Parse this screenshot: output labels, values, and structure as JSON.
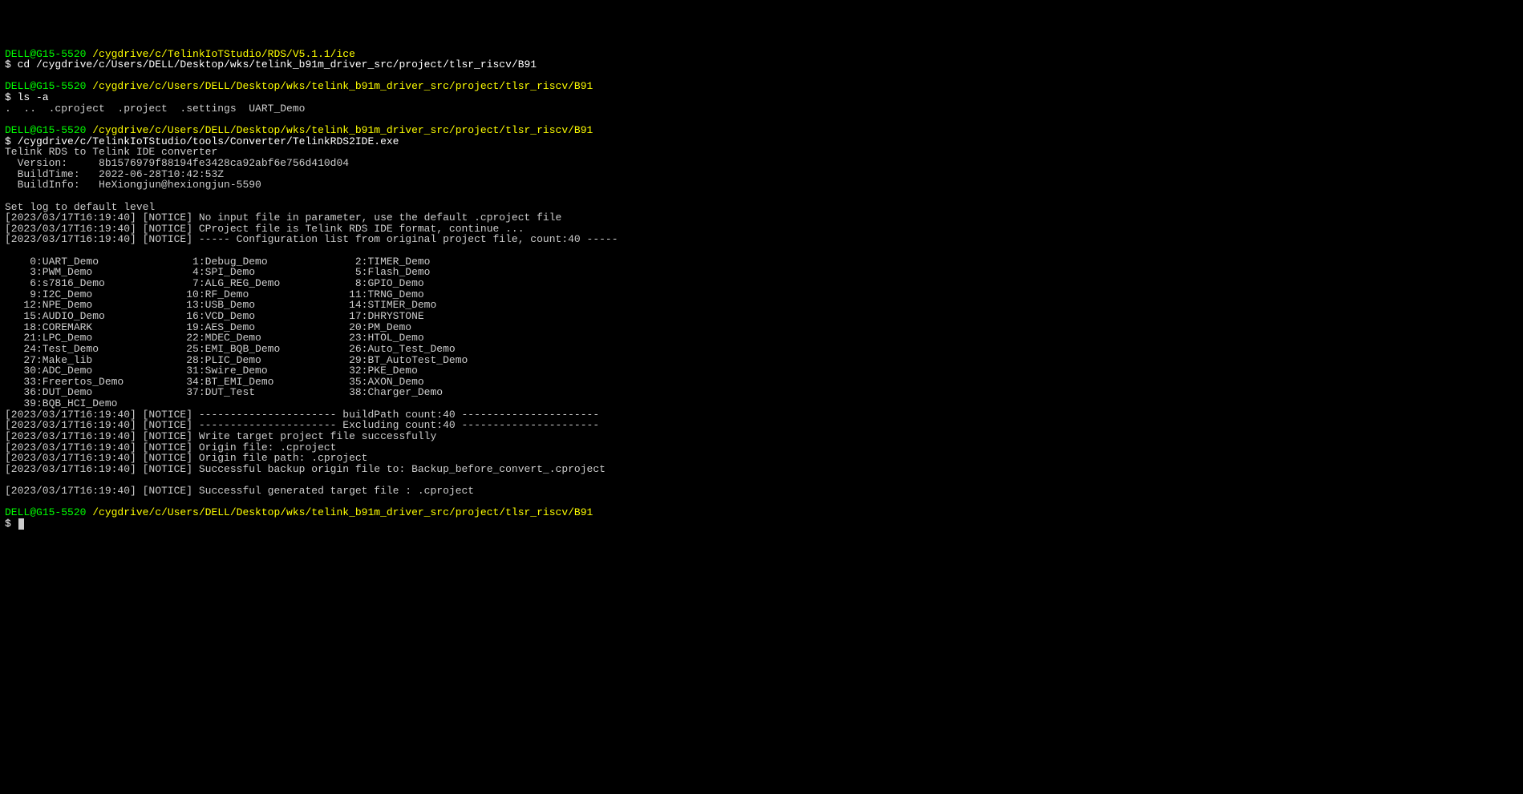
{
  "prompts": [
    {
      "user": "DELL@G15-5520 ",
      "path": "/cygdrive/c/TelinkIoTStudio/RDS/V5.1.1/ice"
    },
    {
      "cmd": "$ cd /cygdrive/c/Users/DELL/Desktop/wks/telink_b91m_driver_src/project/tlsr_riscv/B91"
    },
    {
      "blank": ""
    },
    {
      "user": "DELL@G15-5520 ",
      "path": "/cygdrive/c/Users/DELL/Desktop/wks/telink_b91m_driver_src/project/tlsr_riscv/B91"
    },
    {
      "cmd": "$ ls -a"
    },
    {
      "out": ".  ..  .cproject  .project  .settings  UART_Demo"
    },
    {
      "blank": ""
    },
    {
      "user": "DELL@G15-5520 ",
      "path": "/cygdrive/c/Users/DELL/Desktop/wks/telink_b91m_driver_src/project/tlsr_riscv/B91"
    },
    {
      "cmd": "$ /cygdrive/c/TelinkIoTStudio/tools/Converter/TelinkRDS2IDE.exe"
    },
    {
      "out": "Telink RDS to Telink IDE converter"
    },
    {
      "out": "  Version:     8b1576979f88194fe3428ca92abf6e756d410d04"
    },
    {
      "out": "  BuildTime:   2022-06-28T10:42:53Z"
    },
    {
      "out": "  BuildInfo:   HeXiongjun@hexiongjun-5590"
    },
    {
      "blank": ""
    },
    {
      "out": "Set log to default level"
    },
    {
      "out": "[2023/03/17T16:19:40] [NOTICE] No input file in parameter, use the default .cproject file"
    },
    {
      "out": "[2023/03/17T16:19:40] [NOTICE] CProject file is Telink RDS IDE format, continue ..."
    },
    {
      "out": "[2023/03/17T16:19:40] [NOTICE] ----- Configuration list from original project file, count:40 -----"
    },
    {
      "blank": ""
    },
    {
      "out": "    0:UART_Demo               1:Debug_Demo              2:TIMER_Demo"
    },
    {
      "out": "    3:PWM_Demo                4:SPI_Demo                5:Flash_Demo"
    },
    {
      "out": "    6:s7816_Demo              7:ALG_REG_Demo            8:GPIO_Demo"
    },
    {
      "out": "    9:I2C_Demo               10:RF_Demo                11:TRNG_Demo"
    },
    {
      "out": "   12:NPE_Demo               13:USB_Demo               14:STIMER_Demo"
    },
    {
      "out": "   15:AUDIO_Demo             16:VCD_Demo               17:DHRYSTONE"
    },
    {
      "out": "   18:COREMARK               19:AES_Demo               20:PM_Demo"
    },
    {
      "out": "   21:LPC_Demo               22:MDEC_Demo              23:HTOL_Demo"
    },
    {
      "out": "   24:Test_Demo              25:EMI_BQB_Demo           26:Auto_Test_Demo"
    },
    {
      "out": "   27:Make_lib               28:PLIC_Demo              29:BT_AutoTest_Demo"
    },
    {
      "out": "   30:ADC_Demo               31:Swire_Demo             32:PKE_Demo"
    },
    {
      "out": "   33:Freertos_Demo          34:BT_EMI_Demo            35:AXON_Demo"
    },
    {
      "out": "   36:DUT_Demo               37:DUT_Test               38:Charger_Demo"
    },
    {
      "out": "   39:BQB_HCI_Demo"
    },
    {
      "out": "[2023/03/17T16:19:40] [NOTICE] ---------------------- buildPath count:40 ----------------------"
    },
    {
      "out": "[2023/03/17T16:19:40] [NOTICE] ---------------------- Excluding count:40 ----------------------"
    },
    {
      "out": "[2023/03/17T16:19:40] [NOTICE] Write target project file successfully"
    },
    {
      "out": "[2023/03/17T16:19:40] [NOTICE] Origin file: .cproject"
    },
    {
      "out": "[2023/03/17T16:19:40] [NOTICE] Origin file path: .cproject"
    },
    {
      "out": "[2023/03/17T16:19:40] [NOTICE] Successful backup origin file to: Backup_before_convert_.cproject"
    },
    {
      "blank": ""
    },
    {
      "out": "[2023/03/17T16:19:40] [NOTICE] Successful generated target file : .cproject"
    },
    {
      "blank": ""
    },
    {
      "user": "DELL@G15-5520 ",
      "path": "/cygdrive/c/Users/DELL/Desktop/wks/telink_b91m_driver_src/project/tlsr_riscv/B91"
    },
    {
      "cmd_cursor": "$ "
    }
  ]
}
